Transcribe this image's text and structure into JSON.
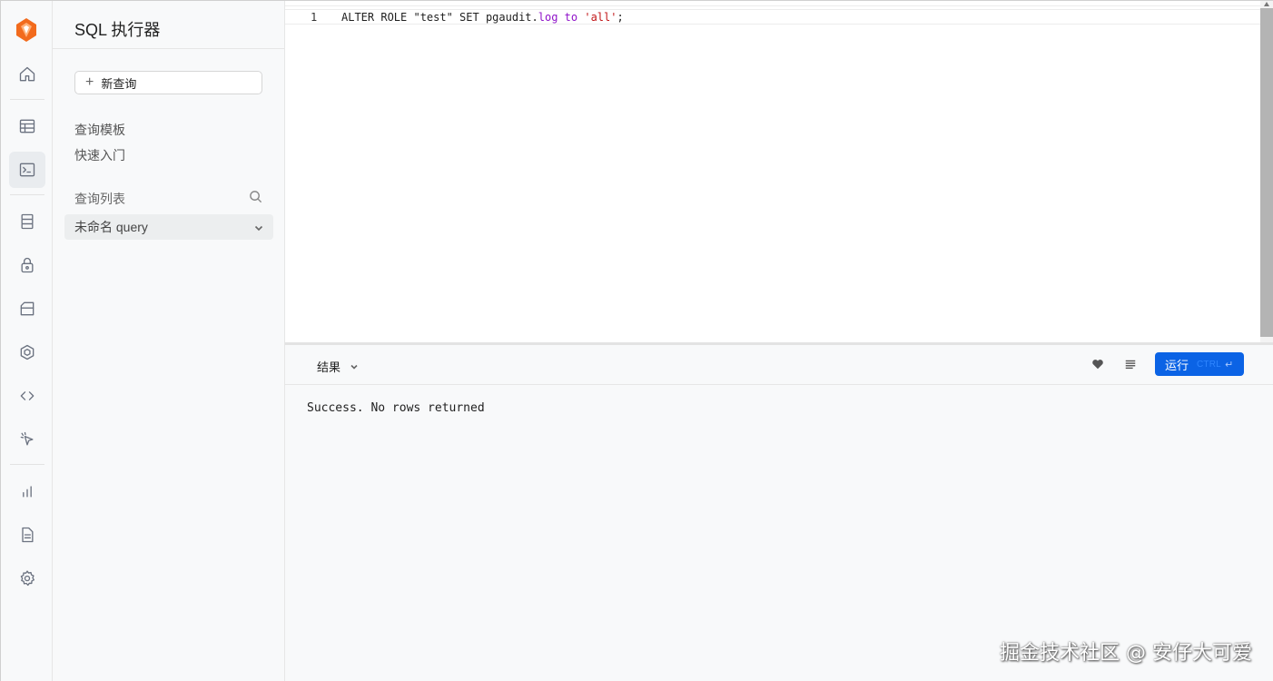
{
  "rail": {
    "items": [
      {
        "name": "home-icon"
      },
      {
        "name": "table-icon"
      },
      {
        "name": "sql-terminal-icon",
        "active": true
      },
      {
        "name": "database-icon"
      },
      {
        "name": "auth-lock-icon"
      },
      {
        "name": "storage-archive-icon"
      },
      {
        "name": "edge-function-icon"
      },
      {
        "name": "api-code-icon"
      },
      {
        "name": "realtime-pointer-icon"
      },
      {
        "name": "reports-bar-chart-icon"
      },
      {
        "name": "logs-document-icon"
      },
      {
        "name": "settings-gear-icon"
      }
    ]
  },
  "panel": {
    "title": "SQL 执行器",
    "new_query_label": "新查询",
    "links": [
      "查询模板",
      "快速入门"
    ],
    "list_header": "查询列表",
    "query_item": "未命名 query"
  },
  "editor": {
    "line_number": "1",
    "code_parts": {
      "a": "ALTER ROLE \"test\" SET pgaudit.",
      "b": "log",
      "c": " ",
      "d": "to",
      "e": " ",
      "f": "'all'",
      "g": ";"
    }
  },
  "results": {
    "tab_label": "结果",
    "run_label": "运行",
    "run_hint": "CTRL",
    "run_enter": "↵",
    "message": "Success. No rows returned"
  },
  "watermark": "掘金技术社区 @ 安仔大可爱",
  "colors": {
    "accent": "#0b63e5",
    "keyword": "#8f12c9",
    "string": "#c2181a",
    "sidebar_bg": "#f8f9fa"
  }
}
